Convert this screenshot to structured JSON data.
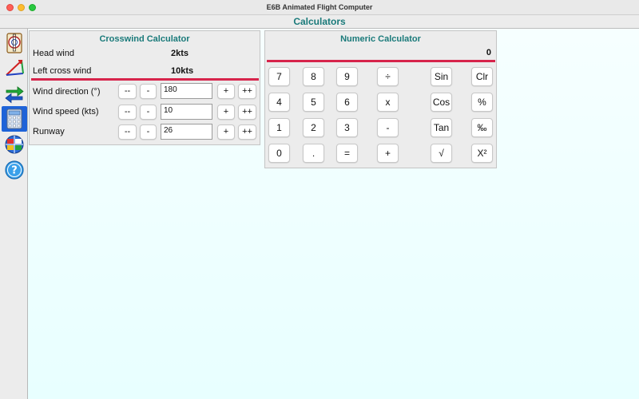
{
  "window": {
    "title": "E6B Animated Flight Computer"
  },
  "header": {
    "title": "Calculators"
  },
  "sidebar": {
    "items": [
      {
        "icon": "flight-computer-icon"
      },
      {
        "icon": "triangle-vector-icon"
      },
      {
        "icon": "unit-conversion-arrows-icon"
      },
      {
        "icon": "calculator-icon",
        "active": true
      },
      {
        "icon": "globe-flags-icon"
      },
      {
        "icon": "help-icon"
      }
    ]
  },
  "crosswind": {
    "title": "Crosswind Calculator",
    "head_wind": {
      "label": "Head wind",
      "value": "2kts"
    },
    "cross_wind": {
      "label": "Left cross wind",
      "value": "10kts"
    },
    "rows": [
      {
        "label": "Wind direction (°)",
        "value": "180"
      },
      {
        "label": "Wind speed (kts)",
        "value": "10"
      },
      {
        "label": "Runway",
        "value": "26"
      }
    ],
    "buttons": {
      "dec_big": "--",
      "dec": "-",
      "inc": "+",
      "inc_big": "++"
    }
  },
  "numeric": {
    "title": "Numeric Calculator",
    "display": "0",
    "keys": [
      [
        "7",
        "8",
        "9",
        "÷",
        "Sin",
        "Clr"
      ],
      [
        "4",
        "5",
        "6",
        "x",
        "Cos",
        "%"
      ],
      [
        "1",
        "2",
        "3",
        "-",
        "Tan",
        "‰"
      ],
      [
        "0",
        ".",
        "=",
        "+",
        "√",
        "X²"
      ]
    ]
  },
  "colors": {
    "accent_teal": "#1a7a7a",
    "divider_red": "#d7244b",
    "active_blue": "#1e63d8"
  }
}
